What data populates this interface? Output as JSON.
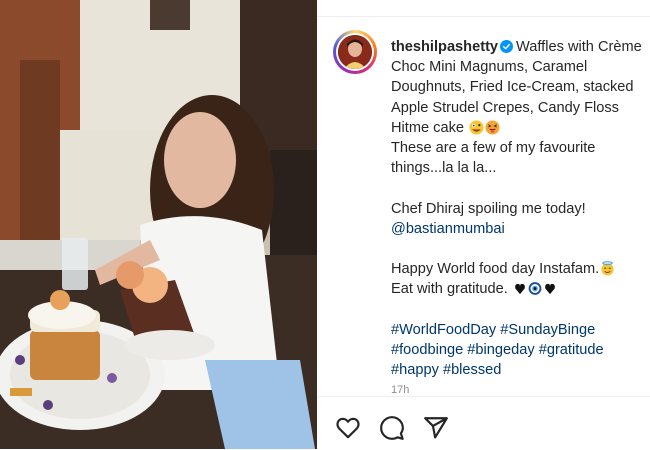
{
  "post": {
    "username": "theshilpashetty",
    "caption_line1": "Waffles with Crème",
    "caption_line2": "Choc Mini Magnums, Caramel",
    "caption_line3": "Doughnuts, Fried Ice-Cream, stacked",
    "caption_line4": "Apple Strudel Crepes, Candy Floss",
    "caption_line5": "Hitme cake",
    "caption_line6": "These are a few of my favourite",
    "caption_line7": "things...la la la...",
    "caption_line8": "Chef Dhiraj spoiling me today!",
    "mention": "@bastianmumbai",
    "caption_line9": "Happy World food day Instafam.",
    "caption_line10": "Eat with gratitude.",
    "hashtags_line1": [
      "#WorldFoodDay",
      "#SundayBinge"
    ],
    "hashtags_line2": [
      "#foodbinge",
      "#bingeday",
      "#gratitude"
    ],
    "hashtags_line3": [
      "#happy",
      "#blessed"
    ],
    "time_ago": "17h"
  },
  "icons": {
    "verified": "verified-badge-icon",
    "like": "heart-icon",
    "comment": "comment-bubble-icon",
    "share": "paper-plane-icon"
  },
  "colors": {
    "text": "#262626",
    "link": "#00376b",
    "verified": "#0095f6",
    "muted": "#8e8e8e"
  }
}
